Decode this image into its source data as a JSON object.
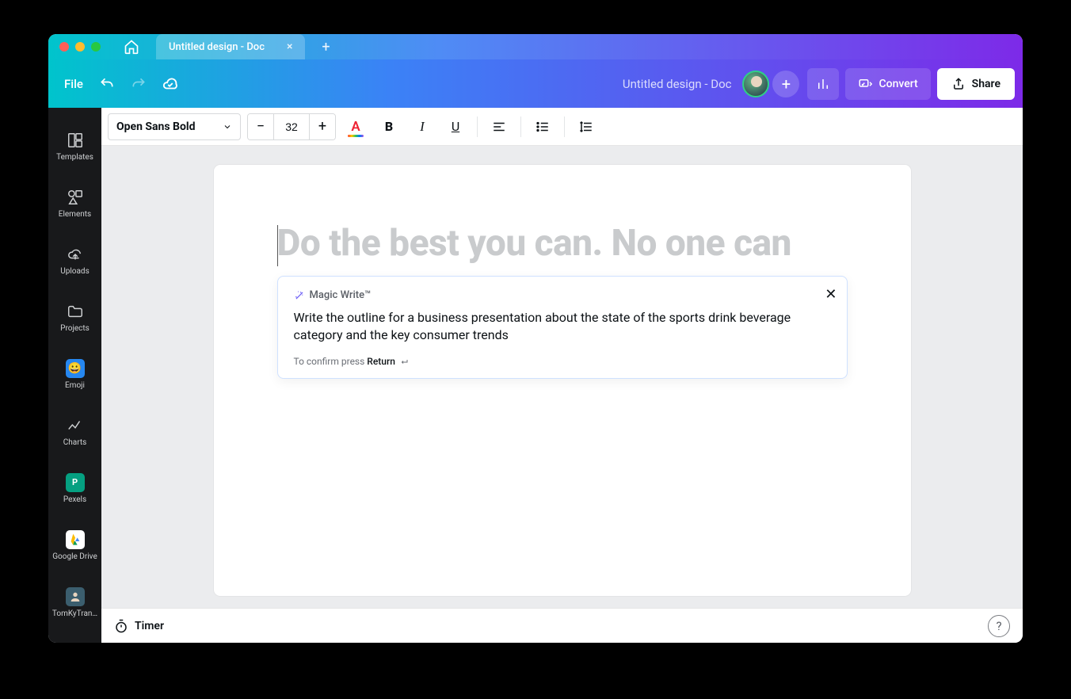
{
  "window": {
    "tab_title": "Untitled design - Doc"
  },
  "topbar": {
    "file_label": "File",
    "doc_title": "Untitled design - Doc",
    "convert_label": "Convert",
    "share_label": "Share"
  },
  "sidebar": {
    "items": [
      {
        "label": "Templates"
      },
      {
        "label": "Elements"
      },
      {
        "label": "Uploads"
      },
      {
        "label": "Projects"
      },
      {
        "label": "Emoji"
      },
      {
        "label": "Charts"
      },
      {
        "label": "Pexels"
      },
      {
        "label": "Google Drive"
      },
      {
        "label": "TomKyTran…"
      }
    ]
  },
  "toolbar": {
    "font_name": "Open Sans Bold",
    "font_size": "32"
  },
  "document": {
    "placeholder": "Do the best you can. No one can"
  },
  "magic": {
    "title": "Magic Write™",
    "prompt": "Write the outline for a business presentation about the state of the sports drink beverage category and the key consumer trends",
    "hint_prefix": "To confirm press ",
    "hint_key": "Return"
  },
  "footer": {
    "timer_label": "Timer"
  }
}
